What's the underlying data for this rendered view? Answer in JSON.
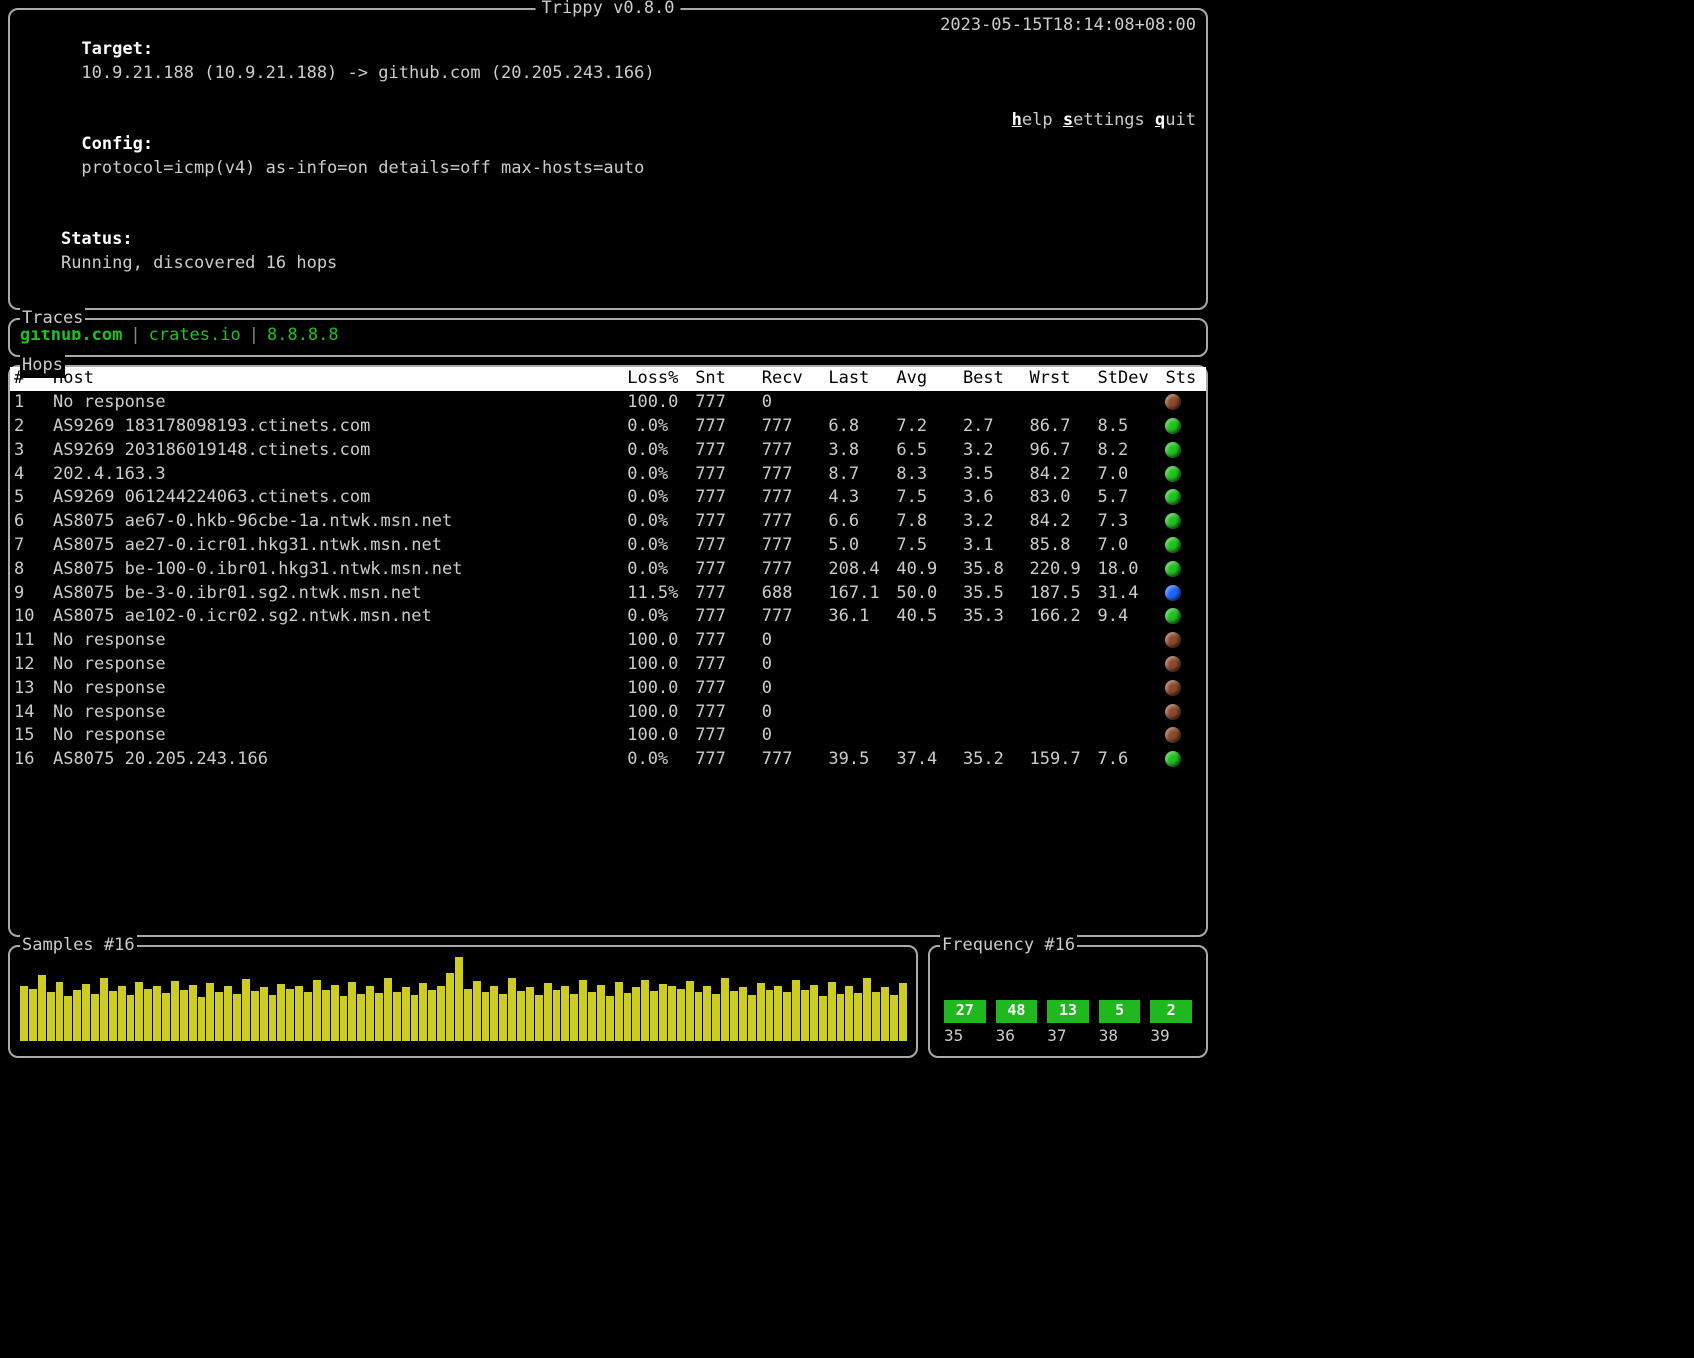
{
  "app_title": "Trippy v0.8.0",
  "header": {
    "target_label": "Target:",
    "target_value": "10.9.21.188 (10.9.21.188) -> github.com (20.205.243.166)",
    "config_label": "Config:",
    "config_value": "protocol=icmp(v4) as-info=on details=off max-hosts=auto",
    "status_label": "Status:",
    "status_value": "Running, discovered 16 hops",
    "timestamp": "2023-05-15T18:14:08+08:00",
    "menu": {
      "help": "elp",
      "settings": "ettings",
      "quit": "uit"
    }
  },
  "traces": {
    "title": "Traces",
    "items": [
      "github.com",
      "crates.io",
      "8.8.8.8"
    ]
  },
  "hops": {
    "title": "Hops",
    "columns": [
      "#",
      "Host",
      "Loss%",
      "Snt",
      "Recv",
      "Last",
      "Avg",
      "Best",
      "Wrst",
      "StDev",
      "Sts"
    ],
    "rows": [
      {
        "n": "1",
        "host": "No response",
        "loss": "100.0",
        "snt": "777",
        "recv": "0",
        "last": "",
        "avg": "",
        "best": "",
        "wrst": "",
        "stdev": "",
        "sts": "#8b4a2b"
      },
      {
        "n": "2",
        "host": "AS9269 183178098193.ctinets.com",
        "loss": "0.0%",
        "snt": "777",
        "recv": "777",
        "last": "6.8",
        "avg": "7.2",
        "best": "2.7",
        "wrst": "86.7",
        "stdev": "8.5",
        "sts": "#1fc21f"
      },
      {
        "n": "3",
        "host": "AS9269 203186019148.ctinets.com",
        "loss": "0.0%",
        "snt": "777",
        "recv": "777",
        "last": "3.8",
        "avg": "6.5",
        "best": "3.2",
        "wrst": "96.7",
        "stdev": "8.2",
        "sts": "#1fc21f"
      },
      {
        "n": "4",
        "host": "202.4.163.3",
        "loss": "0.0%",
        "snt": "777",
        "recv": "777",
        "last": "8.7",
        "avg": "8.3",
        "best": "3.5",
        "wrst": "84.2",
        "stdev": "7.0",
        "sts": "#1fc21f"
      },
      {
        "n": "5",
        "host": "AS9269 061244224063.ctinets.com",
        "loss": "0.0%",
        "snt": "777",
        "recv": "777",
        "last": "4.3",
        "avg": "7.5",
        "best": "3.6",
        "wrst": "83.0",
        "stdev": "5.7",
        "sts": "#1fc21f"
      },
      {
        "n": "6",
        "host": "AS8075 ae67-0.hkb-96cbe-1a.ntwk.msn.net",
        "loss": "0.0%",
        "snt": "777",
        "recv": "777",
        "last": "6.6",
        "avg": "7.8",
        "best": "3.2",
        "wrst": "84.2",
        "stdev": "7.3",
        "sts": "#1fc21f"
      },
      {
        "n": "7",
        "host": "AS8075 ae27-0.icr01.hkg31.ntwk.msn.net",
        "loss": "0.0%",
        "snt": "777",
        "recv": "777",
        "last": "5.0",
        "avg": "7.5",
        "best": "3.1",
        "wrst": "85.8",
        "stdev": "7.0",
        "sts": "#1fc21f"
      },
      {
        "n": "8",
        "host": "AS8075 be-100-0.ibr01.hkg31.ntwk.msn.net",
        "loss": "0.0%",
        "snt": "777",
        "recv": "777",
        "last": "208.4",
        "avg": "40.9",
        "best": "35.8",
        "wrst": "220.9",
        "stdev": "18.0",
        "sts": "#1fc21f"
      },
      {
        "n": "9",
        "host": "AS8075 be-3-0.ibr01.sg2.ntwk.msn.net",
        "loss": "11.5%",
        "snt": "777",
        "recv": "688",
        "last": "167.1",
        "avg": "50.0",
        "best": "35.5",
        "wrst": "187.5",
        "stdev": "31.4",
        "sts": "#1e66ff"
      },
      {
        "n": "10",
        "host": "AS8075 ae102-0.icr02.sg2.ntwk.msn.net",
        "loss": "0.0%",
        "snt": "777",
        "recv": "777",
        "last": "36.1",
        "avg": "40.5",
        "best": "35.3",
        "wrst": "166.2",
        "stdev": "9.4",
        "sts": "#1fc21f"
      },
      {
        "n": "11",
        "host": "No response",
        "loss": "100.0",
        "snt": "777",
        "recv": "0",
        "last": "",
        "avg": "",
        "best": "",
        "wrst": "",
        "stdev": "",
        "sts": "#8b4a2b"
      },
      {
        "n": "12",
        "host": "No response",
        "loss": "100.0",
        "snt": "777",
        "recv": "0",
        "last": "",
        "avg": "",
        "best": "",
        "wrst": "",
        "stdev": "",
        "sts": "#8b4a2b"
      },
      {
        "n": "13",
        "host": "No response",
        "loss": "100.0",
        "snt": "777",
        "recv": "0",
        "last": "",
        "avg": "",
        "best": "",
        "wrst": "",
        "stdev": "",
        "sts": "#8b4a2b"
      },
      {
        "n": "14",
        "host": "No response",
        "loss": "100.0",
        "snt": "777",
        "recv": "0",
        "last": "",
        "avg": "",
        "best": "",
        "wrst": "",
        "stdev": "",
        "sts": "#8b4a2b"
      },
      {
        "n": "15",
        "host": "No response",
        "loss": "100.0",
        "snt": "777",
        "recv": "0",
        "last": "",
        "avg": "",
        "best": "",
        "wrst": "",
        "stdev": "",
        "sts": "#8b4a2b"
      },
      {
        "n": "16",
        "host": "AS8075 20.205.243.166",
        "loss": "0.0%",
        "snt": "777",
        "recv": "777",
        "last": "39.5",
        "avg": "37.4",
        "best": "35.2",
        "wrst": "159.7",
        "stdev": "7.6",
        "sts": "#1fc21f"
      }
    ]
  },
  "samples": {
    "title": "Samples #16",
    "values": [
      58,
      55,
      70,
      52,
      62,
      48,
      54,
      60,
      50,
      66,
      53,
      58,
      49,
      62,
      55,
      58,
      51,
      63,
      54,
      59,
      47,
      61,
      52,
      58,
      50,
      65,
      53,
      57,
      49,
      60,
      55,
      58,
      52,
      64,
      54,
      59,
      48,
      62,
      50,
      58,
      51,
      66,
      52,
      57,
      49,
      61,
      54,
      58,
      72,
      88,
      55,
      63,
      52,
      58,
      50,
      66,
      53,
      57,
      49,
      61,
      54,
      58,
      50,
      64,
      52,
      59,
      48,
      62,
      51,
      57,
      64,
      53,
      60,
      58,
      55,
      63,
      52,
      58,
      50,
      66,
      53,
      57,
      49,
      61,
      54,
      58,
      52,
      64,
      54,
      59,
      48,
      62,
      50,
      58,
      51,
      66,
      52,
      57,
      49,
      61
    ]
  },
  "chart_data": {
    "type": "bar",
    "title": "Frequency #16",
    "categories": [
      "35",
      "36",
      "37",
      "38",
      "39"
    ],
    "values": [
      27,
      48,
      13,
      5,
      2
    ],
    "xlabel": "",
    "ylabel": "",
    "ylim": [
      0,
      50
    ]
  }
}
